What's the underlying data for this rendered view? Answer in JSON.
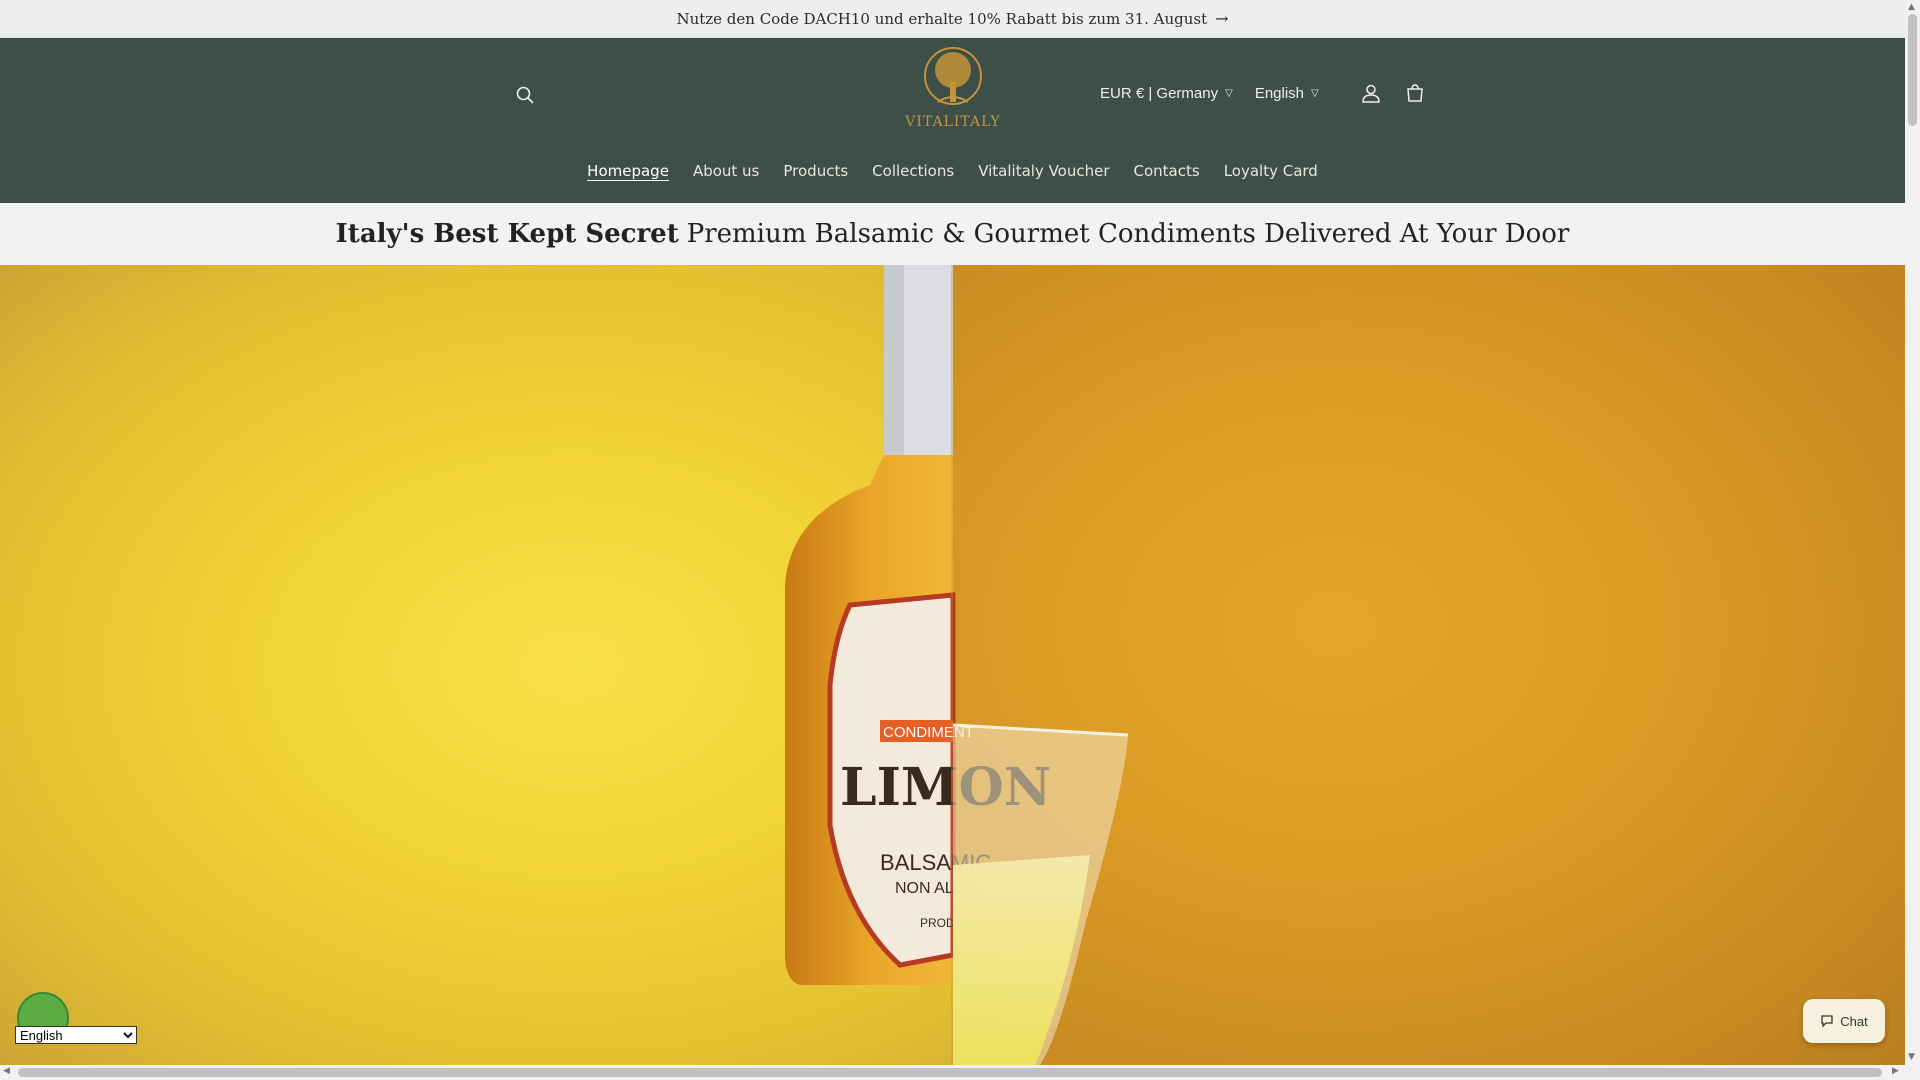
{
  "announcement": {
    "text": "Nutze den Code DACH10 und erhalte 10% Rabatt bis zum 31. August",
    "arrow": "→"
  },
  "header": {
    "logo_text": "VITALITALY",
    "currency": "EUR € | Germany",
    "language": "English"
  },
  "nav": {
    "items": [
      {
        "label": "Homepage"
      },
      {
        "label": "About us"
      },
      {
        "label": "Products"
      },
      {
        "label": "Collections"
      },
      {
        "label": "Vitalitaly Voucher"
      },
      {
        "label": "Contacts"
      },
      {
        "label": "Loyalty Card"
      }
    ]
  },
  "tagline": {
    "bold": "Italy's Best Kept Secret",
    "rest": "Premium Balsamic & Gourmet Condiments Delivered At Your Door"
  },
  "hero": {
    "label_top": "CONDIMENT",
    "label_main": "LIMON",
    "label_sub1": "BALSAMIC",
    "label_sub2": "NON ALCO",
    "label_sub3": "PRODU"
  },
  "chat": {
    "label": "Chat"
  },
  "language_widget": {
    "selected": "English"
  },
  "colors": {
    "header_bg": "#3d4f48",
    "accent_gold": "#c4943a",
    "hero_left": "#f2d536",
    "hero_right": "#dc9b25"
  }
}
